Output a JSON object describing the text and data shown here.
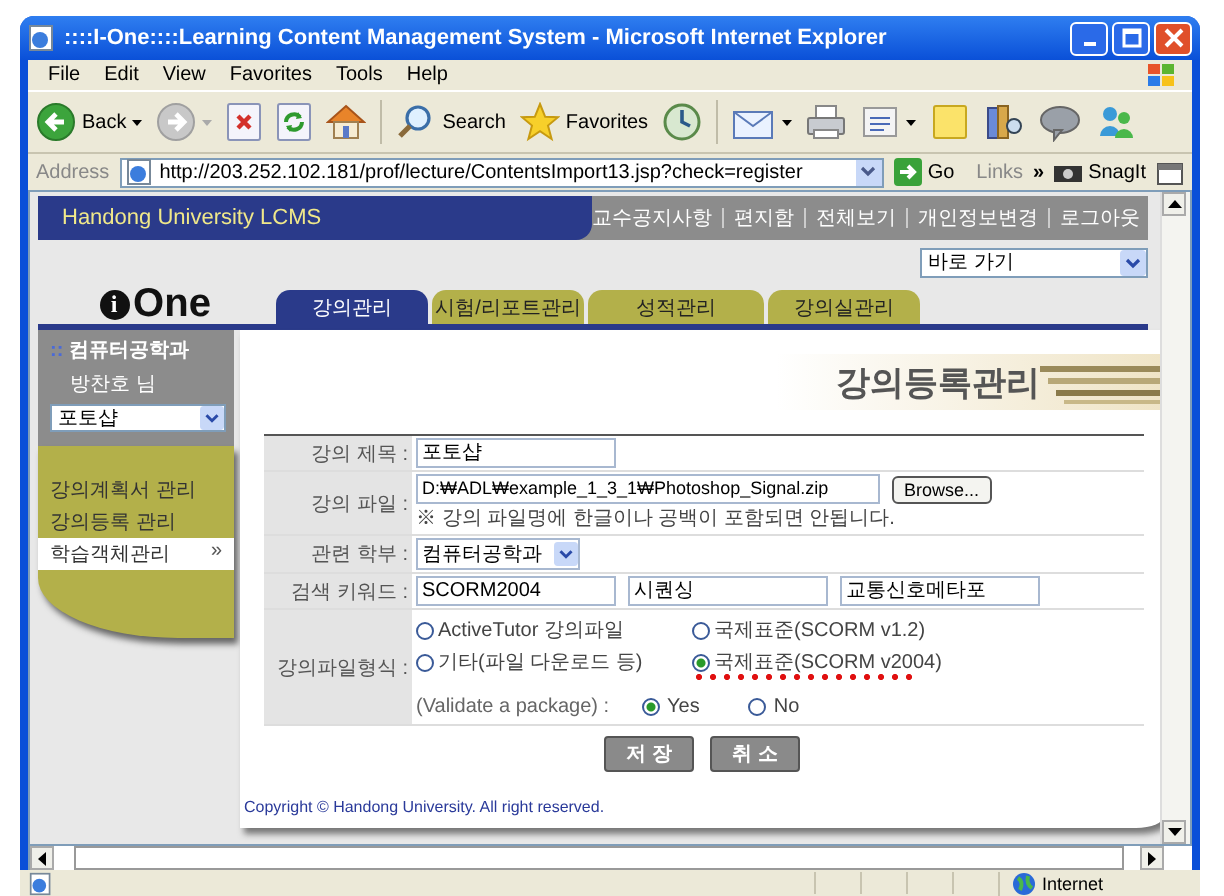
{
  "window": {
    "title": "::::I-One::::Learning Content Management System - Microsoft Internet Explorer"
  },
  "menu": [
    "File",
    "Edit",
    "View",
    "Favorites",
    "Tools",
    "Help"
  ],
  "toolbar": [
    {
      "kind": "back",
      "label": "Back",
      "dropdown": true
    },
    {
      "kind": "forward",
      "dropdown": true
    },
    {
      "kind": "stop"
    },
    {
      "kind": "refresh"
    },
    {
      "kind": "home"
    },
    {
      "kind": "search",
      "label": "Search"
    },
    {
      "kind": "favorites",
      "label": "Favorites"
    },
    {
      "kind": "history"
    },
    {
      "kind": "mail",
      "dropdown": true
    },
    {
      "kind": "print"
    },
    {
      "kind": "edit",
      "dropdown": true
    },
    {
      "kind": "note"
    },
    {
      "kind": "research"
    },
    {
      "kind": "chat"
    },
    {
      "kind": "messenger"
    }
  ],
  "address": {
    "label": "Address",
    "url": "http://203.252.102.181/prof/lecture/ContentsImport13.jsp?check=register",
    "go": "Go",
    "links": "Links",
    "links_more": "»",
    "snagit": "SnagIt"
  },
  "site": {
    "title": "Handong University LCMS",
    "top_links": [
      "교수공지사항",
      "편지함",
      "전체보기",
      "개인정보변경",
      "로그아웃"
    ],
    "quick_select": "바로 가기",
    "logo": {
      "mark": "i",
      "text": "One"
    },
    "tabs": [
      {
        "label": "강의관리",
        "selected": true
      },
      {
        "label": "시험/리포트관리",
        "selected": false
      },
      {
        "label": "성적관리",
        "selected": false
      },
      {
        "label": "강의실관리",
        "selected": false
      }
    ]
  },
  "sidebar": {
    "bullet": "::",
    "department": "컴퓨터공학과",
    "user": "방찬호 님",
    "course": "포토샵",
    "items": [
      {
        "label": "강의계획서 관리",
        "selected": false
      },
      {
        "label": "강의등록 관리",
        "selected": false
      },
      {
        "label": "학습객체관리",
        "selected": true,
        "arrow": "»"
      }
    ]
  },
  "heading": "강의등록관리",
  "form": {
    "title": {
      "label": "강의 제목 :",
      "value": "포토샵"
    },
    "file": {
      "label": "강의 파일 :",
      "value": "D:₩ADL₩example_1_3_1₩Photoshop_Signal.zip",
      "browse": "Browse...",
      "note": "※ 강의 파일명에 한글이나 공백이 포함되면 안됩니다."
    },
    "department": {
      "label": "관련 학부 :",
      "value": "컴퓨터공학과"
    },
    "keywords": {
      "label": "검색 키워드 :",
      "values": [
        "SCORM2004",
        "시퀀싱",
        "교통신호메타포"
      ]
    },
    "format": {
      "label": "강의파일형식 :",
      "options": [
        {
          "label": "ActiveTutor 강의파일",
          "selected": false,
          "underlined": false
        },
        {
          "label": "국제표준(SCORM v1.2)",
          "selected": false,
          "underlined": false
        },
        {
          "label": "기타(파일 다운로드 등)",
          "selected": false,
          "underlined": false
        },
        {
          "label": "국제표준(SCORM v2004)",
          "selected": true,
          "underlined": true
        }
      ]
    },
    "validate": {
      "label": "(Validate a package) :",
      "options": [
        {
          "label": "Yes",
          "selected": true
        },
        {
          "label": "No",
          "selected": false
        }
      ]
    }
  },
  "buttons": [
    "저 장",
    "취 소"
  ],
  "copyright": "Copyright © Handong University. All right reserved.",
  "status": {
    "zone": "Internet"
  }
}
